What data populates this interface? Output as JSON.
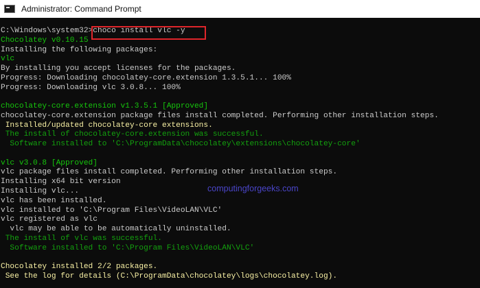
{
  "window": {
    "title": "Administrator: Command Prompt"
  },
  "console": {
    "lines": [
      {
        "text": "C:\\Windows\\system32>choco install vlc -y",
        "color": "white"
      },
      {
        "text": "Chocolatey v0.10.15",
        "color": "lime"
      },
      {
        "text": "Installing the following packages:",
        "color": "white"
      },
      {
        "text": "vlc",
        "color": "lime"
      },
      {
        "text": "By installing you accept licenses for the packages.",
        "color": "white"
      },
      {
        "text": "Progress: Downloading chocolatey-core.extension 1.3.5.1... 100%",
        "color": "white"
      },
      {
        "text": "Progress: Downloading vlc 3.0.8... 100%",
        "color": "white"
      },
      {
        "text": "",
        "color": "white"
      },
      {
        "text": "chocolatey-core.extension v1.3.5.1 [Approved]",
        "color": "lime"
      },
      {
        "text": "chocolatey-core.extension package files install completed. Performing other installation steps.",
        "color": "white"
      },
      {
        "text": " Installed/updated chocolatey-core extensions.",
        "color": "yellow"
      },
      {
        "text": " The install of chocolatey-core.extension was successful.",
        "color": "green"
      },
      {
        "text": "  Software installed to 'C:\\ProgramData\\chocolatey\\extensions\\chocolatey-core'",
        "color": "green"
      },
      {
        "text": "",
        "color": "white"
      },
      {
        "text": "vlc v3.0.8 [Approved]",
        "color": "lime"
      },
      {
        "text": "vlc package files install completed. Performing other installation steps.",
        "color": "white"
      },
      {
        "text": "Installing x64 bit version",
        "color": "white"
      },
      {
        "text": "Installing vlc...",
        "color": "white"
      },
      {
        "text": "vlc has been installed.",
        "color": "white"
      },
      {
        "text": "vlc installed to 'C:\\Program Files\\VideoLAN\\VLC'",
        "color": "white"
      },
      {
        "text": "vlc registered as vlc",
        "color": "white"
      },
      {
        "text": "  vlc may be able to be automatically uninstalled.",
        "color": "white"
      },
      {
        "text": " The install of vlc was successful.",
        "color": "green"
      },
      {
        "text": "  Software installed to 'C:\\Program Files\\VideoLAN\\VLC'",
        "color": "green"
      },
      {
        "text": "",
        "color": "white"
      },
      {
        "text": "Chocolatey installed 2/2 packages.",
        "color": "yellow"
      },
      {
        "text": " See the log for details (C:\\ProgramData\\chocolatey\\logs\\chocolatey.log).",
        "color": "yellow"
      }
    ]
  },
  "watermark": "computingforgeeks.com",
  "colors": {
    "highlight": "#e0262b",
    "green": "#13a10e",
    "lime": "#16c60c",
    "yellow": "#f9f1a5"
  }
}
